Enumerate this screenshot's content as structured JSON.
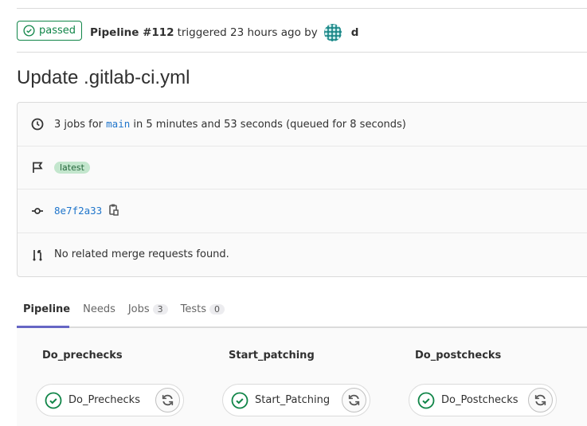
{
  "header": {
    "status": "passed",
    "pipeline_label": "Pipeline #112",
    "triggered_text": "triggered 23 hours ago by",
    "user": "d"
  },
  "title": "Update .gitlab-ci.yml",
  "info": {
    "jobs_prefix": "3 jobs for",
    "branch": "main",
    "jobs_suffix": "in 5 minutes and 53 seconds (queued for 8 seconds)",
    "tag": "latest",
    "commit": "8e7f2a33",
    "merge_requests": "No related merge requests found."
  },
  "tabs": [
    {
      "label": "Pipeline"
    },
    {
      "label": "Needs"
    },
    {
      "label": "Jobs",
      "count": "3"
    },
    {
      "label": "Tests",
      "count": "0"
    }
  ],
  "stages": [
    {
      "name": "Do_prechecks",
      "job": "Do_Prechecks"
    },
    {
      "name": "Start_patching",
      "job": "Start_Patching"
    },
    {
      "name": "Do_postchecks",
      "job": "Do_Postchecks"
    }
  ],
  "colors": {
    "success": "#108548",
    "link": "#1f75cb",
    "tab_active": "#6666c4"
  }
}
